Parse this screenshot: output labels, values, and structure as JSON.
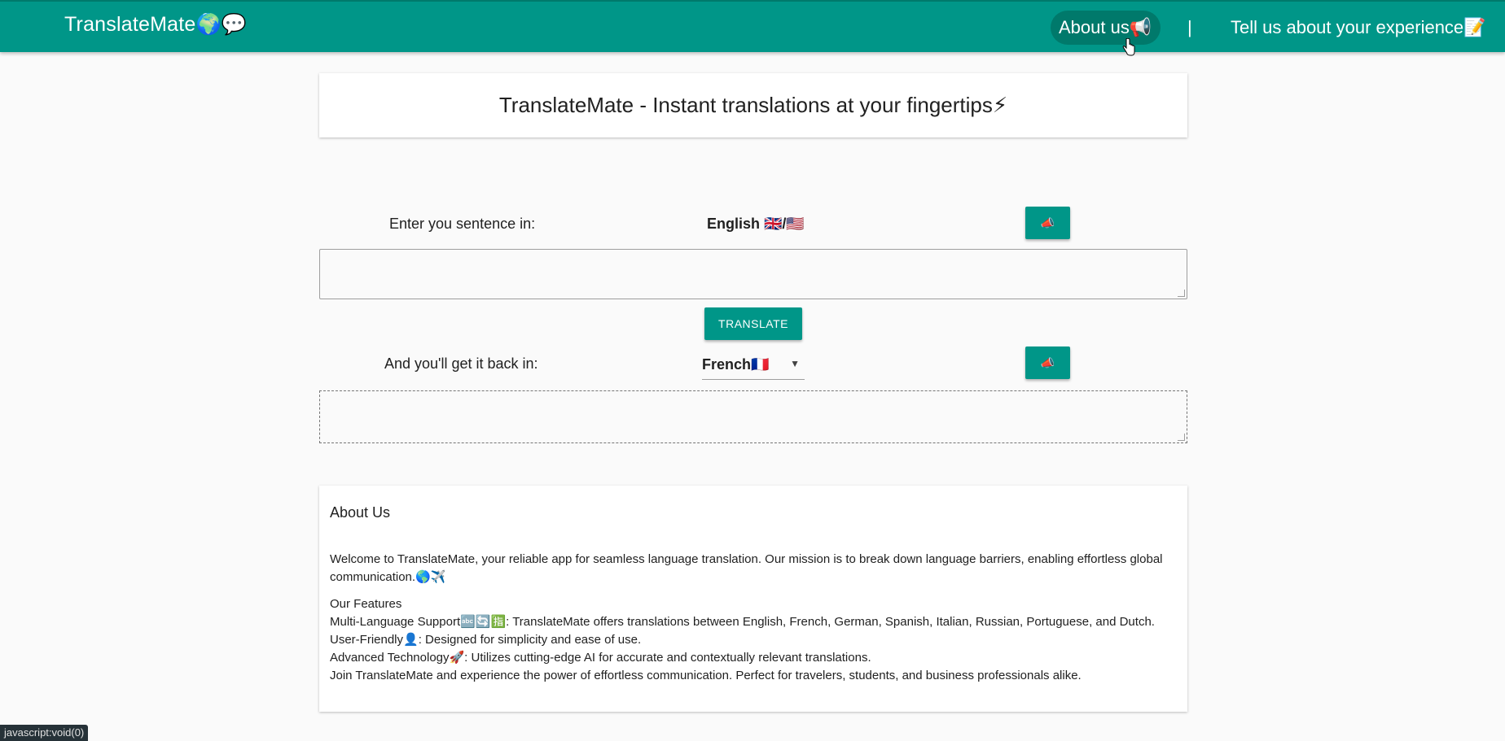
{
  "navbar": {
    "brand": "TranslateMate🌍💬",
    "about_link": "About us📢",
    "separator": "|",
    "experience_link": "Tell us about your experience📝",
    "bg_color": "#009688"
  },
  "header": {
    "title": "TranslateMate - Instant translations at your fingertips⚡"
  },
  "input_section": {
    "label": "Enter you sentence in:",
    "language": "English 🇬🇧/🇺🇸",
    "speak_icon": "📣",
    "text_value": "",
    "placeholder": ""
  },
  "translate_button": {
    "label": "TRANSLATE"
  },
  "output_section": {
    "label": "And you'll get it back in:",
    "selected_language": "French🇫🇷",
    "caret": "▼",
    "speak_icon": "📣",
    "text_value": ""
  },
  "about": {
    "title": "About Us",
    "intro": "Welcome to TranslateMate, your reliable app for seamless language translation. Our mission is to break down language barriers, enabling effortless global communication.🌎✈️",
    "features_heading": "Our Features",
    "features": [
      "Multi-Language Support🔤🔄🈯: TranslateMate offers translations between English, French, German, Spanish, Italian, Russian, Portuguese, and Dutch.",
      "User-Friendly👤: Designed for simplicity and ease of use.",
      "Advanced Technology🚀: Utilizes cutting-edge AI for accurate and contextually relevant translations.",
      "Join TranslateMate and experience the power of effortless communication. Perfect for travelers, students, and business professionals alike."
    ]
  },
  "status_bar": {
    "text": "javascript:void(0)"
  }
}
